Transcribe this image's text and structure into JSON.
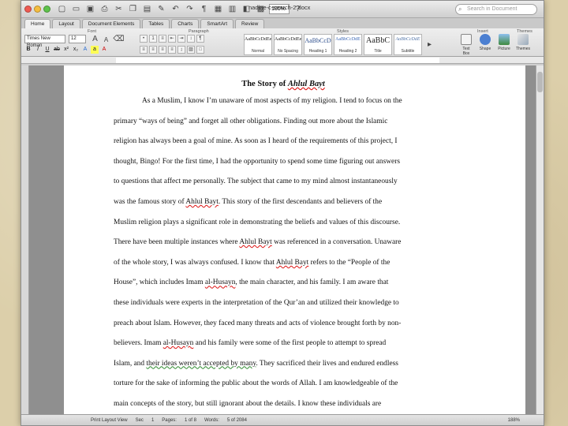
{
  "window": {
    "document_title": "nadine-c-search-2.docx",
    "zoom": "100%"
  },
  "search": {
    "placeholder": "Search in Document"
  },
  "tabs": [
    "Home",
    "Layout",
    "Document Elements",
    "Tables",
    "Charts",
    "SmartArt",
    "Review"
  ],
  "ribbon": {
    "group_font": "Font",
    "group_paragraph": "Paragraph",
    "group_styles": "Styles",
    "group_insert": "Insert",
    "group_themes": "Themes",
    "font_name": "Times New Roman",
    "font_size": "12",
    "styles": [
      {
        "sample": "AaBbCcDdEe",
        "name": "Normal"
      },
      {
        "sample": "AaBbCcDdEe",
        "name": "No Spacing"
      },
      {
        "sample": "AaBbCcD",
        "name": "Heading 1"
      },
      {
        "sample": "AaBbCcDdE",
        "name": "Heading 2"
      },
      {
        "sample": "AaBbC",
        "name": "Title"
      },
      {
        "sample": "AaBbCcDdE",
        "name": "Subtitle"
      }
    ],
    "insert_items": [
      "Text Box",
      "Shape",
      "Picture",
      "Themes"
    ]
  },
  "document": {
    "title_prefix": "The Story of ",
    "title_emph": "Ahlul Bayt",
    "lines": [
      "As a Muslim, I know I’m unaware of most aspects of my religion. I tend to focus on the",
      "primary “ways of being” and forget all other obligations. Finding out more about the Islamic",
      "religion has always been a goal of mine. As soon as I heard of the requirements of this project, I",
      "thought, Bingo! For the first time, I had the opportunity to spend some time figuring out answers",
      "to questions that affect me personally. The subject that came to my mind almost instantaneously",
      "was the famous story of Ahlul Bayt. This story of the first descendants and believers of the",
      "Muslim religion plays a significant role in demonstrating the beliefs and values of this discourse.",
      "There have been multiple instances where Ahlul Bayt was referenced in a conversation. Unaware",
      "of the whole story, I was always confused. I know that Ahlul Bayt refers to the “People of the",
      "House”, which includes Imam al-Husayn, the main character, and his family. I am aware that",
      "these individuals were experts in the interpretation of the Qur’an and utilized their knowledge to",
      "preach about Islam. However, they faced many threats and acts of violence brought forth by non-",
      "believers. Imam al-Husayn and his family were some of the first people to attempt to spread",
      "Islam, and their ideas weren’t accepted by many. They sacrificed their lives and endured endless",
      "torture for the sake of informing the public about the words of Allah. I am knowledgeable of the",
      "main concepts of the story, but still ignorant about the details. I know these individuals are"
    ]
  },
  "status": {
    "view": "Print Layout View",
    "sec": "Sec",
    "sec_val": "1",
    "pages": "Pages:",
    "pages_val": "1 of 8",
    "words": "Words:",
    "words_val": "5 of 2084",
    "zoom": "188%"
  }
}
